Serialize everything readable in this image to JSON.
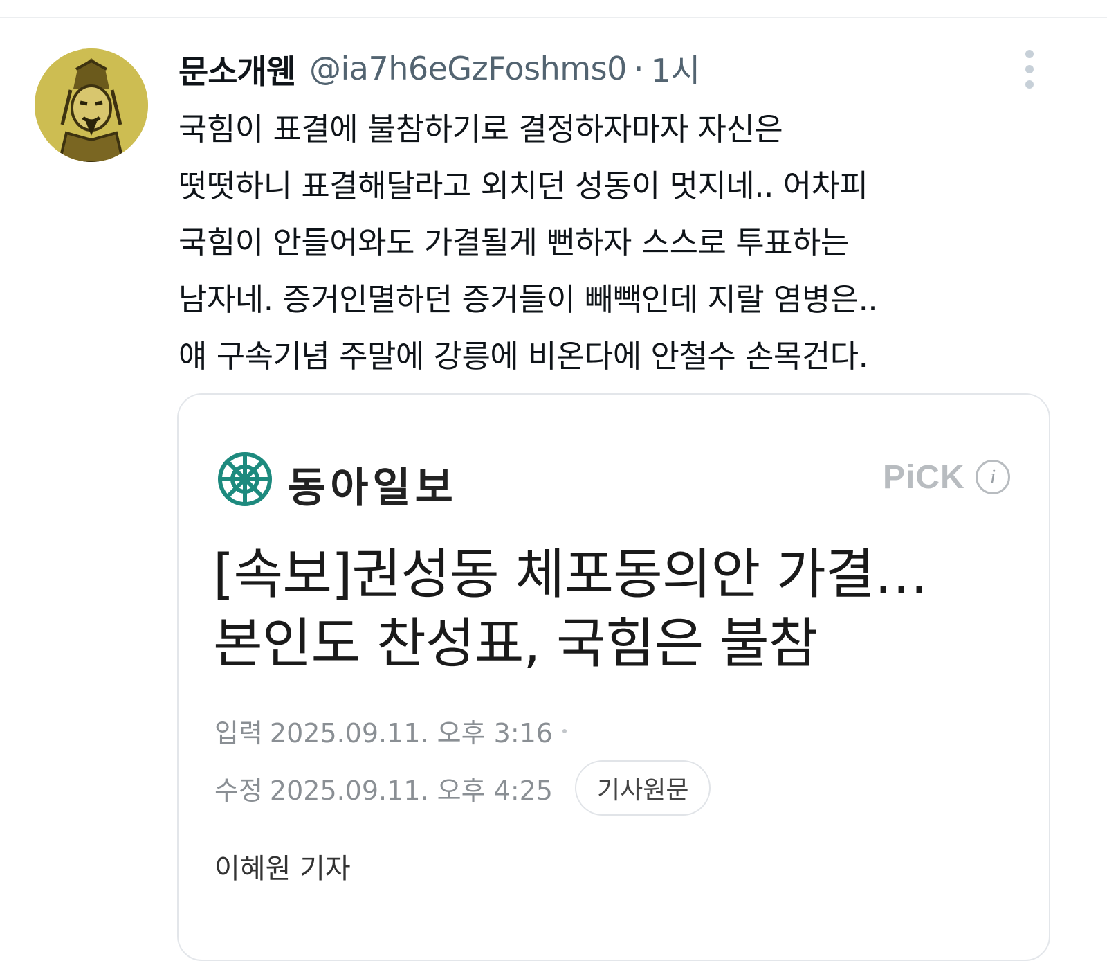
{
  "tweet": {
    "display_name": "문소개웬",
    "handle": "@ia7h6eGzFoshms0",
    "separator": "·",
    "time": "1시",
    "avatar_icon": "avatar-portrait-icon",
    "more_icon": "more-vertical-icon",
    "text_lines": [
      "국힘이 표결에 불참하기로 결정하자마자 자신은",
      "떳떳하니 표결해달라고 외치던 성동이 멋지네.. 어차피",
      "국힘이 안들어와도 가결될게 뻔하자 스스로 투표하는",
      "남자네. 증거인멸하던 증거들이 빼빽인데 지랄 염병은..",
      "얘 구속기념 주말에 강릉에 비온다에 안철수 손목건다."
    ]
  },
  "card": {
    "press_name": "동아일보",
    "press_logo_icon": "donga-logo-icon",
    "pick_label": "PiCK",
    "info_icon_glyph": "i",
    "headline_lines": [
      "[속보]권성동 체포동의안 가결…",
      "본인도 찬성표, 국힘은 불참"
    ],
    "input_label": "입력",
    "input_time": "2025.09.11. 오후 3:16",
    "modified_label": "수정",
    "modified_time": "2025.09.11. 오후 4:25",
    "original_button": "기사원문",
    "reporter": "이혜원 기자"
  },
  "colors": {
    "logo_teal": "#1d8a7e",
    "muted_text": "#536471",
    "avatar_bg": "#cdbd52"
  }
}
